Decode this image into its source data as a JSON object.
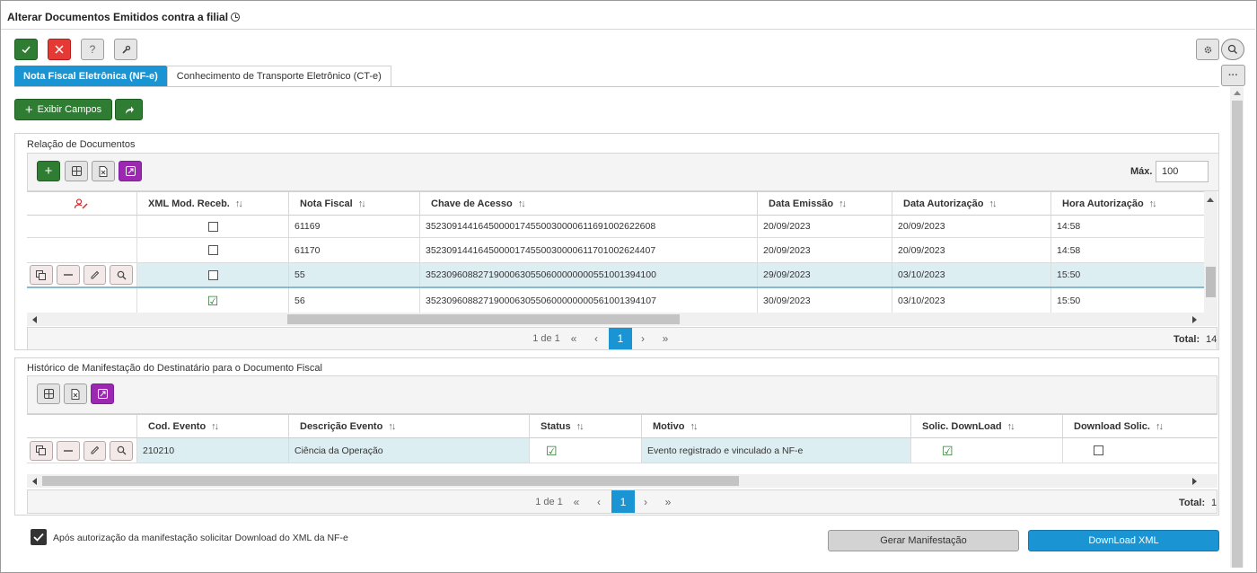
{
  "window": {
    "title": "Alterar Documentos Emitidos contra a filial"
  },
  "toolbar": {
    "confirm_icon": "check-icon",
    "cancel_icon": "close-icon",
    "help_label": "?",
    "tools_icon": "wrench-icon"
  },
  "tabs": [
    {
      "label": "Nota Fiscal Eletrônica (NF-e)",
      "active": true
    },
    {
      "label": "Conhecimento de Transporte Eletrônico (CT-e)",
      "active": false
    }
  ],
  "actions": {
    "exibir_campos": "Exibir Campos",
    "plus": "+",
    "more": "···"
  },
  "documentos": {
    "section_title": "Relação de Documentos",
    "max_label": "Máx.",
    "max_value": "100",
    "columns": [
      "XML Mod. Receb.",
      "Nota Fiscal",
      "Chave de Acesso",
      "Data Emissão",
      "Data Autorização",
      "Hora Autorização"
    ],
    "rows": [
      {
        "xml": false,
        "nota": "61169",
        "chave": "35230914416450000174550030000611691002622608",
        "emissao": "20/09/2023",
        "autorizacao": "20/09/2023",
        "hora": "14:58",
        "selected": false
      },
      {
        "xml": false,
        "nota": "61170",
        "chave": "35230914416450000174550030000611701002624407",
        "emissao": "20/09/2023",
        "autorizacao": "20/09/2023",
        "hora": "14:58",
        "selected": false
      },
      {
        "xml": false,
        "nota": "55",
        "chave": "35230960882719000630550600000000551001394100",
        "emissao": "29/09/2023",
        "autorizacao": "03/10/2023",
        "hora": "15:50",
        "selected": true
      },
      {
        "xml": true,
        "nota": "56",
        "chave": "35230960882719000630550600000000561001394107",
        "emissao": "30/09/2023",
        "autorizacao": "03/10/2023",
        "hora": "15:50",
        "selected": false
      }
    ],
    "pager": {
      "page_info": "1 de 1",
      "first": "«",
      "prev": "‹",
      "current": "1",
      "next": "›",
      "last": "»",
      "total_label": "Total:",
      "total_value": "14"
    }
  },
  "historico": {
    "section_title": "Histórico de Manifestação do Destinatário para o Documento Fiscal",
    "columns": [
      "Cod. Evento",
      "Descrição Evento",
      "Status",
      "Motivo",
      "Solic. DownLoad",
      "Download Solic."
    ],
    "rows": [
      {
        "cod": "210210",
        "descricao": "Ciência da Operação",
        "status": true,
        "motivo": "Evento registrado e vinculado a NF-e",
        "solic": true,
        "download": false
      }
    ],
    "pager": {
      "page_info": "1 de 1",
      "first": "«",
      "prev": "‹",
      "current": "1",
      "next": "›",
      "last": "»",
      "total_label": "Total:",
      "total_value": "1"
    }
  },
  "footer": {
    "auto_download_label": "Após autorização da manifestação solicitar Download do XML da NF-e",
    "auto_download_checked": true,
    "gerar_label": "Gerar Manifestação",
    "download_label": "DownLoad XML"
  },
  "colors": {
    "primary": "#1a94d2",
    "green": "#2e7d32",
    "red": "#e53935",
    "purple": "#9c27b0",
    "selected_row": "#ddeef3"
  }
}
